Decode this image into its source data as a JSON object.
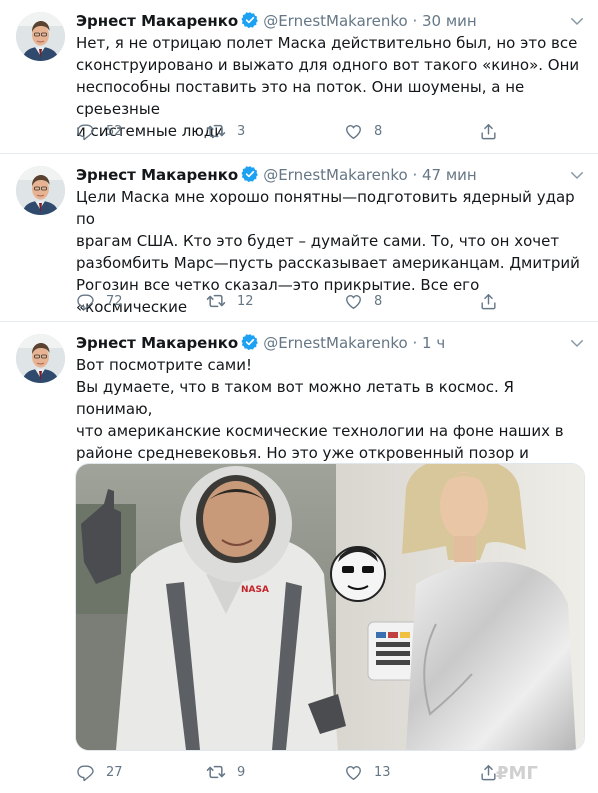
{
  "colors": {
    "accent": "#1da1f2",
    "text": "#14171a",
    "secondary": "#657786",
    "divider": "#e6ecf0"
  },
  "tweets": [
    {
      "name": "Эрнест Макаренко",
      "handle": "@ErnestMakarenko",
      "dot": "·",
      "time": "30 мин",
      "text": "Нет, я не отрицаю полет Маска действительно был, но это все\nсконструировано и выжато для одного вот такого «кино». Они\nнеспособны поставить это на поток. Они шоумены, а не среьезные\nи системные люди",
      "replies": "52",
      "retweets": "3",
      "likes": "8"
    },
    {
      "name": "Эрнест Макаренко",
      "handle": "@ErnestMakarenko",
      "dot": "·",
      "time": "47 мин",
      "text": "Цели Маска мне хорошо понятны—подготовить ядерный удар по\nврагам США. Кто это будет – думайте сами. То, что он хочет\nразбомбить Марс—пусть рассказывает американцам. Дмитрий\nРогозин все четко сказал—это прикрытие. Все его «космические\nпрограммы» прикрытие для захватнической войны",
      "replies": "72",
      "retweets": "12",
      "likes": "8"
    },
    {
      "name": "Эрнест Макаренко",
      "handle": "@ErnestMakarenko",
      "dot": "·",
      "time": "1 ч",
      "text": "Вот посмотрите сами!\nВы думаете, что в таком вот можно летать в космос. Я понимаю,\nчто американские космические технологии на фоне наших в\nрайоне средневековья. Но это уже откровенный позор и\nпостановка!",
      "replies": "27",
      "retweets": "9",
      "likes": "13"
    }
  ],
  "icons": {
    "verified": "verified-badge-icon",
    "caret": "chevron-down-icon",
    "reply": "reply-icon",
    "retweet": "retweet-icon",
    "like": "heart-icon",
    "share": "share-icon"
  },
  "media": {
    "nasa_logo": "NASA"
  },
  "watermark": "₽МГ"
}
